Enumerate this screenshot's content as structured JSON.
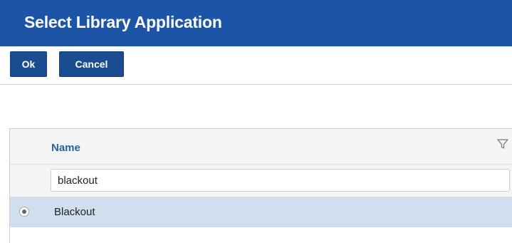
{
  "dialog": {
    "title": "Select Library Application"
  },
  "toolbar": {
    "ok_label": "Ok",
    "cancel_label": "Cancel"
  },
  "grid": {
    "columns": [
      {
        "label": "Name",
        "filter_icon": "filter-icon"
      }
    ],
    "filter": {
      "value": "blackout",
      "placeholder": ""
    },
    "rows": [
      {
        "name": "Blackout",
        "selected": true
      }
    ]
  },
  "colors": {
    "header_bg": "#1c55a8",
    "button_bg": "#1a4c92",
    "column_header_text": "#2b5fa8",
    "selected_row_bg": "#d0dfee"
  }
}
